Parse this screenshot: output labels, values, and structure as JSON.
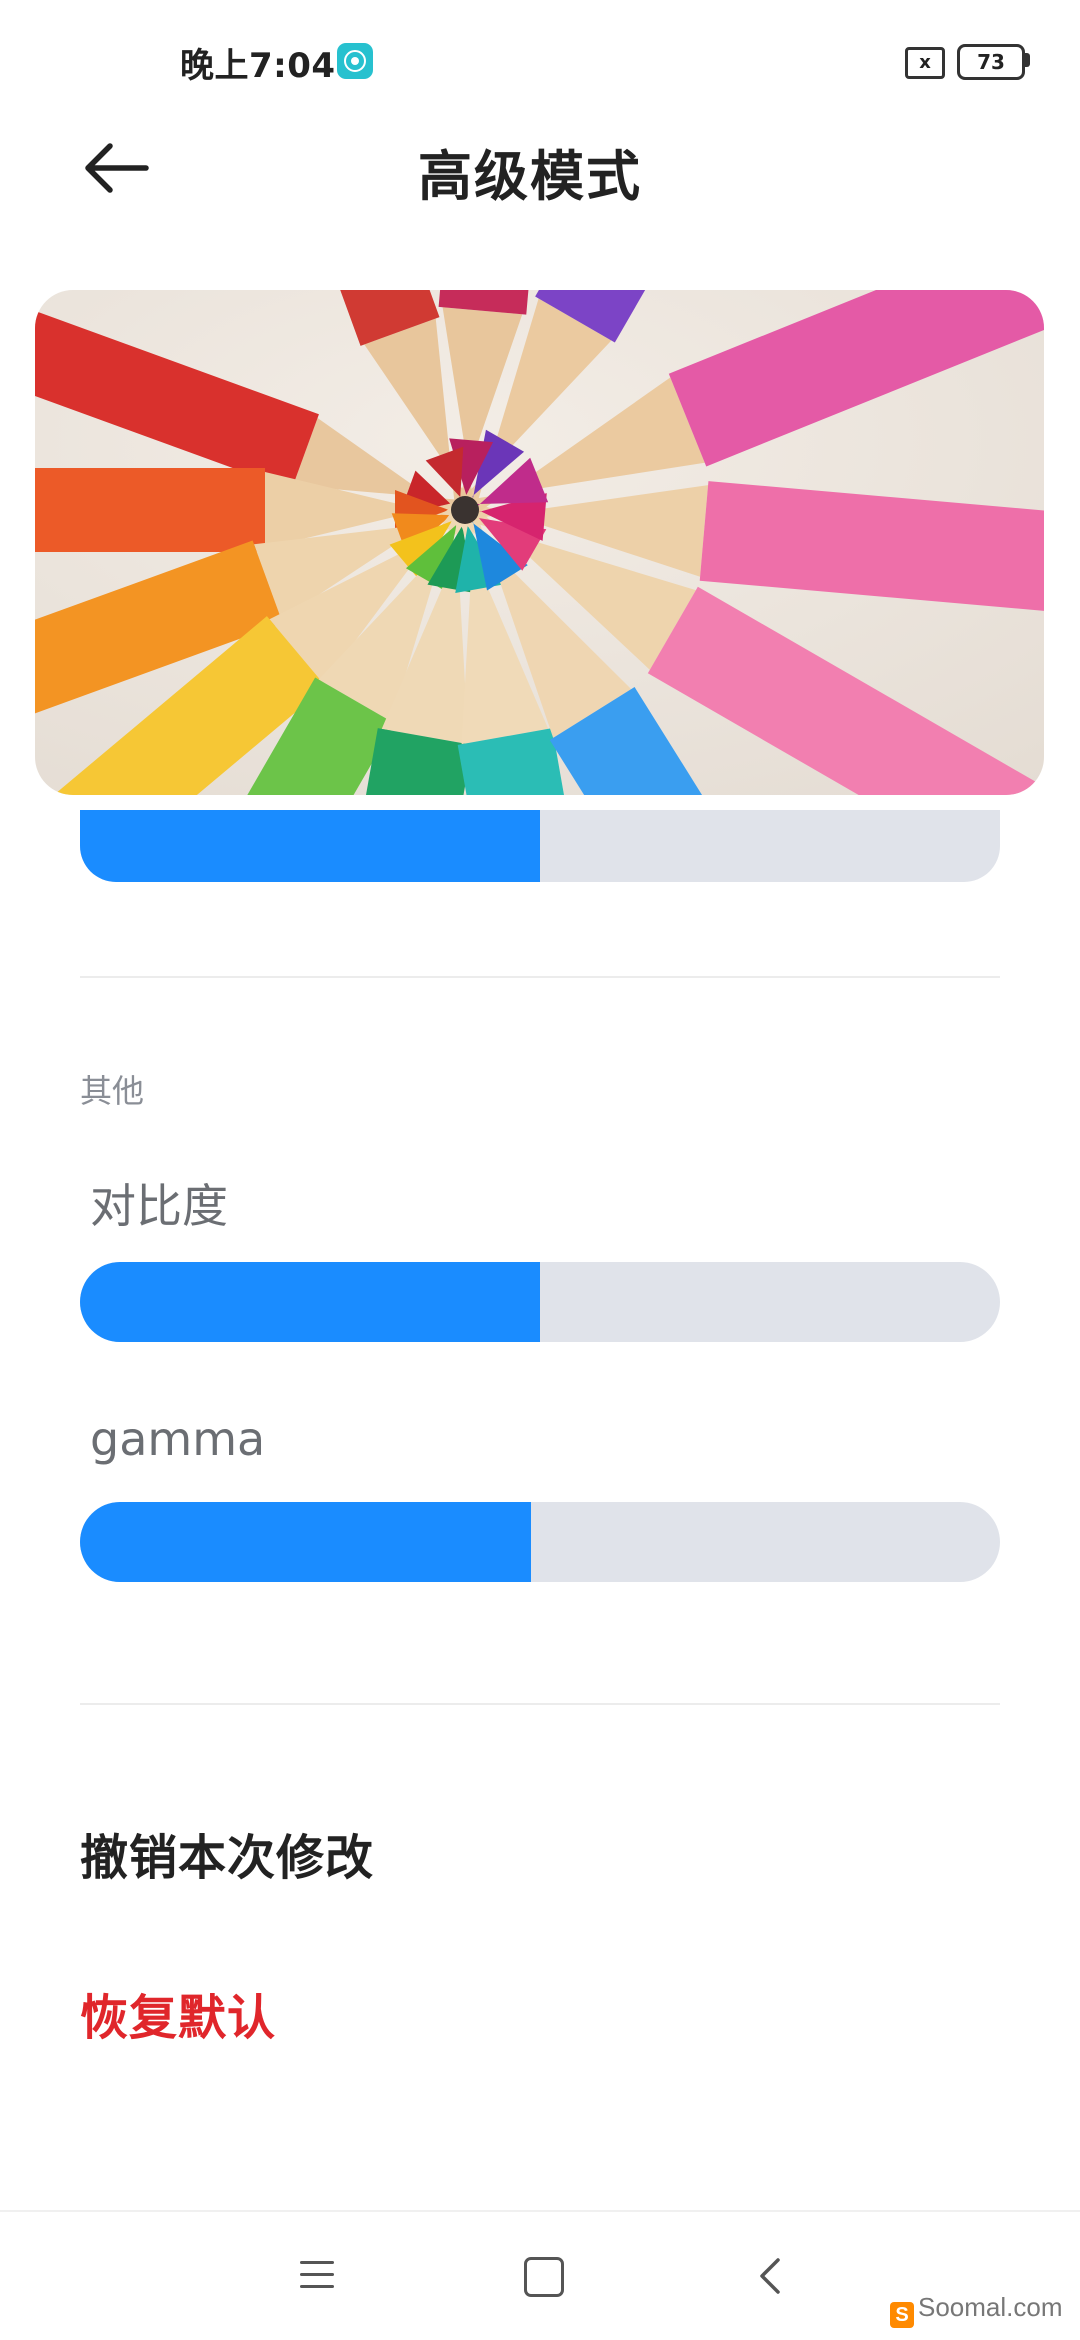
{
  "status_bar": {
    "time": "晚上7:04",
    "sim_icon": "x",
    "battery": "73",
    "app_icon": "teal-circle-app-icon"
  },
  "header": {
    "title": "高级模式",
    "back_icon": "arrow-left-icon"
  },
  "preview": {
    "description_icon": "colored-pencils-image"
  },
  "sliders": {
    "cropped_value": 0.5,
    "contrast": {
      "label": "对比度",
      "value": 0.5
    },
    "gamma": {
      "label": "gamma",
      "value": 0.49
    }
  },
  "sections": {
    "other_label": "其他"
  },
  "actions": {
    "undo_label": "撤销本次修改",
    "reset_label": "恢复默认"
  },
  "nav": {
    "menu_icon": "menu-icon",
    "home_icon": "home-icon",
    "back_icon": "chevron-left-icon"
  },
  "watermark": {
    "text": "Soomal.com",
    "logo_letter": "S"
  },
  "colors": {
    "accent": "#1a8cff",
    "track": "#e0e3ea",
    "danger": "#e0262b"
  }
}
